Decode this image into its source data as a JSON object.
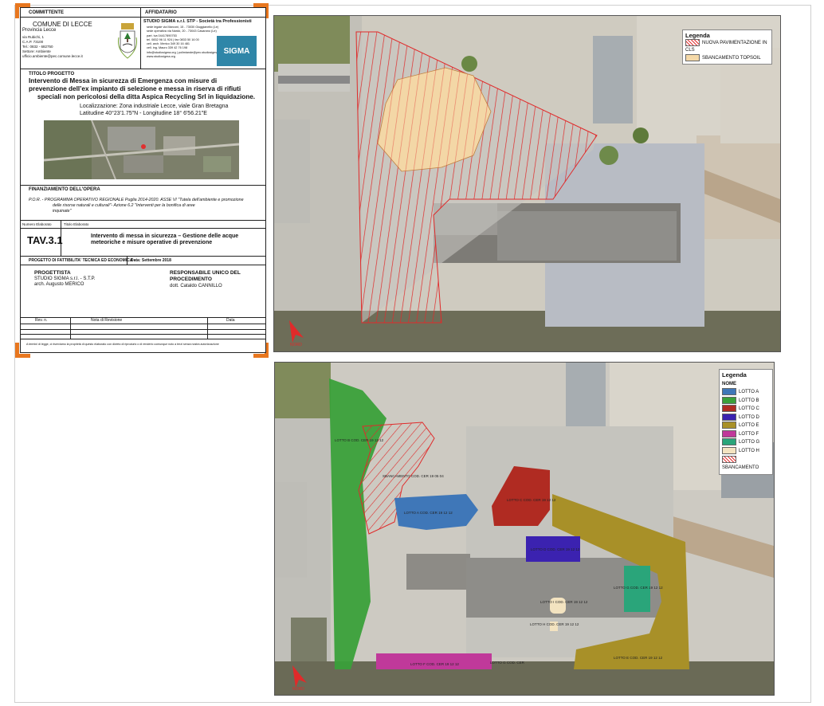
{
  "title_block": {
    "committente_label": "COMMITTENTE",
    "affidatario_label": "AFFIDATARIO",
    "comune": "COMUNE DI LECCE",
    "provincia": "Provincia Lecce",
    "committente_lines": [
      "via Rubichi, 1",
      "C.A.P. 73100",
      "Tel.: 0832 - 682750",
      "Settore: Ambiente",
      "ufficio.ambiente@pec.comune.lecce.it"
    ],
    "studio_name": "STUDIO SIGMA s.r.l. STP - Società tra Professionisti",
    "studio_lines": [
      "sede legale via Marconi, 15 - 73030 Giuggianello (Le)",
      "sede operativa via Nardò, 20 - 73043 Casarano (Le)",
      "part. iva 04417890753",
      "tel. 0832 96 11 924 | fax 0833 50 16 00",
      "cell. arch. Merico 349 30 16 481",
      "cell. ing. Mauro 339 42 76 198",
      "info@studiosigma.org | polimiande@pec.studiosigma.org",
      "www.studiosigma.org"
    ],
    "sigma_logo_text": "SIGMA",
    "titolo_label": "TITOLO PROGETTO",
    "titolo_lines": [
      "Intervento di Messa in sicurezza di Emergenza con misure di",
      "prevenzione dell’ex impianto di selezione e messa in riserva di rifiuti",
      "speciali non pericolosi della ditta Aspica Recycling Srl in liquidazione."
    ],
    "localizzazione": "Localizzazione: Zona industriale Lecce, viale Gran Bretagna",
    "coordinate": "Latitudine 40°23'1.75\"N - Longitudine 18° 6'56.21\"E",
    "finanziamento_label": "FINANZIAMENTO DELL'OPERA",
    "finanziamento_lines": [
      "P.O.R. - PROGRAMMA OPERATIVO REGIONALE Puglia 2014-2020.    ASSE VI \"Tutela dell'ambiente e promozione",
      "delle risorse naturali e culturali\"- Azione 6.2 \"Interventi per la bonifica di aree",
      "inquinate\""
    ],
    "numero_label": "Numero Elaborato",
    "titolo_elab_label": "Titolo Elaborato",
    "tav": "TAV.3.1",
    "elaborato_lines": [
      "Intervento di messa in sicurezza – Gestione delle acque",
      "meteoriche e misure operative di prevenzione"
    ],
    "progetto_label": "PROGETTO DI FATTIBILITA' TECNICA ED ECONOMICA",
    "data_label": "Data: Settembre 2018",
    "progettista_label": "PROGETTISTA",
    "progettista_lines": [
      "STUDIO SIGMA s.r.l. - S.T.P.",
      "arch. Augusto MERICO"
    ],
    "rup_label_lines": [
      "RESPONSABILE UNICO DEL",
      "PROCEDIMENTO"
    ],
    "rup_name": "dott. Cataldo CANNILLO",
    "rev_headers": [
      "Rev. n.",
      "Nota di Revisione",
      "Data"
    ],
    "footer_note": "A termini di legge, ci riserviamo la proprietà di questo elaborato con divieto di riprodurlo o di renderlo comunque noto a terzi senza nostra autorizzazione"
  },
  "map_top": {
    "legend_title": "Legenda",
    "legend_items": [
      {
        "label": "NUOVA PAVIMENTAZIONE IN CLS",
        "color": "#e03030",
        "pattern": "hatch"
      },
      {
        "label": "SBANCAMENTO TOPSOIL",
        "color": "#f5d9a8",
        "pattern": "solid"
      }
    ],
    "north_label": "NORD"
  },
  "map_bottom": {
    "legend_title": "Legenda",
    "legend_subtitle": "NOME",
    "legend_items": [
      {
        "label": "LOTTO A",
        "color": "#3f77b8"
      },
      {
        "label": "LOTTO B",
        "color": "#3aa03a"
      },
      {
        "label": "LOTTO C",
        "color": "#b02b22"
      },
      {
        "label": "LOTTO D",
        "color": "#3b22b0"
      },
      {
        "label": "LOTTO E",
        "color": "#a89028"
      },
      {
        "label": "LOTTO F",
        "color": "#c0399a"
      },
      {
        "label": "LOTTO G",
        "color": "#2aa57a"
      },
      {
        "label": "LOTTO H",
        "color": "#f3e3c0"
      },
      {
        "label": "SBANCAMENTO",
        "color": "#e03030"
      }
    ],
    "lot_labels": {
      "b": "LOTTO B COD. CER 19 12 12",
      "a": "LOTTO A COD. CER 19 12 12",
      "sb": "SBANCAMENTO COD. CER 19 05 04",
      "c": "LOTTO C COD. CER 19 12 12",
      "d": "LOTTO D COD. CER 19 12 12",
      "g": "LOTTO G COD. CER 19 12 12",
      "h": "LOTTO H COD. CER 19 12 12",
      "f": "LOTTO F COD. CER 19 12 12",
      "e": "LOTTO E COD. CER 19 12 12",
      "x": "LOTTO I COD. CER 19 12 12",
      "y": "LOTTO G COD. CER"
    },
    "north_label": "NORD"
  }
}
